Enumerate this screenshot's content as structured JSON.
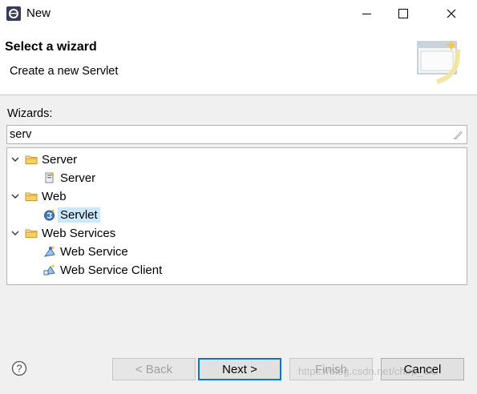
{
  "window": {
    "title": "New"
  },
  "header": {
    "title": "Select a wizard",
    "subtitle": "Create a new Servlet"
  },
  "wizards": {
    "label": "Wizards:",
    "filter_value": "serv",
    "tree": [
      {
        "label": "Server",
        "icon": "folder-icon",
        "expanded": true,
        "children": [
          {
            "label": "Server",
            "icon": "server-wizard-icon"
          }
        ]
      },
      {
        "label": "Web",
        "icon": "folder-icon",
        "expanded": true,
        "children": [
          {
            "label": "Servlet",
            "icon": "servlet-icon",
            "selected": true
          }
        ]
      },
      {
        "label": "Web Services",
        "icon": "folder-icon",
        "expanded": true,
        "children": [
          {
            "label": "Web Service",
            "icon": "web-service-icon"
          },
          {
            "label": "Web Service Client",
            "icon": "web-service-client-icon"
          }
        ]
      }
    ]
  },
  "buttons": {
    "back": "< Back",
    "next": "Next >",
    "finish": "Finish",
    "cancel": "Cancel"
  },
  "watermark": "https://blog.csdn.net/chirp_CC",
  "colors": {
    "selection": "#cce8ff",
    "default_button_border": "#0078d7",
    "folder": "#e8b84a"
  }
}
